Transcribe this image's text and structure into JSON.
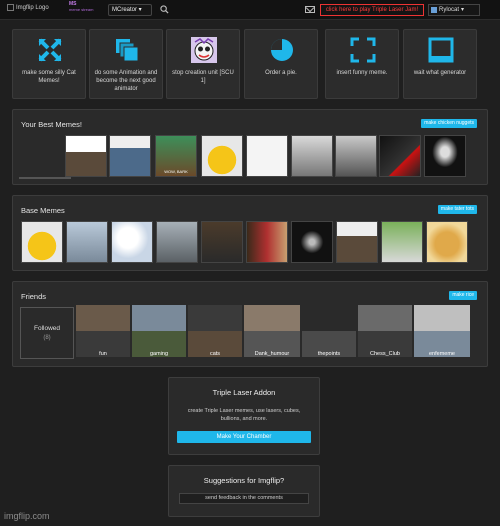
{
  "topbar": {
    "logo_alt": "Imgflip Logo",
    "ms_badge": "MS",
    "ms_badge_sub": "meme stream",
    "stream_select": "MCreator",
    "promo": "click here to play Triple Laser Jam!",
    "username": "Rylocat"
  },
  "shortcuts": [
    {
      "label": "make some silly Cat Memes!",
      "icon": "x-arrows-icon"
    },
    {
      "label": "do some Animation and become the next good animator",
      "icon": "stacked-frames-icon"
    },
    {
      "label": "stop creation unit [SCU 1]",
      "icon": "character-face-icon"
    },
    {
      "label": "Order a pie.",
      "icon": "pie-chart-icon"
    },
    {
      "label": "insert funny meme.",
      "icon": "fullscreen-icon"
    },
    {
      "label": "wait what generator",
      "icon": "window-icon"
    }
  ],
  "best_memes": {
    "title": "Your Best Memes!",
    "button": "make chicken nuggets",
    "caption": "WOW, BARK"
  },
  "base_memes": {
    "title": "Base Memes",
    "button": "make tater tots"
  },
  "friends": {
    "title": "Friends",
    "button": "make rice",
    "followed_label": "Followed",
    "followed_count": "(8)",
    "folders": [
      "fun",
      "gaming",
      "cats",
      "Dank_humour",
      "thepoints",
      "Chess_Club",
      "enfememe"
    ]
  },
  "addon": {
    "title": "Triple Laser Addon",
    "desc": "create Triple Laser memes, use lasers, cubes, bullions, and more.",
    "button": "Make Your Chamber"
  },
  "suggest": {
    "title": "Suggestions for Imgflip?",
    "field": "send feedback in the comments"
  },
  "footer": "imgflip.com",
  "colors": {
    "accent": "#1fb7ea",
    "promo": "#ff3b3b",
    "panel": "#2a2a2a"
  }
}
